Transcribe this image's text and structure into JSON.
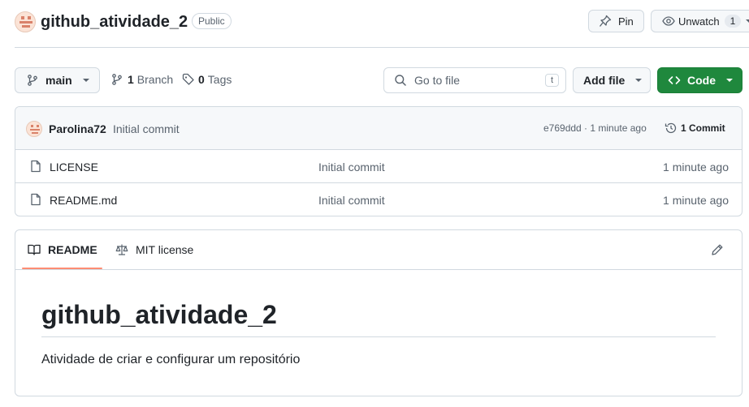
{
  "repo": {
    "name": "github_atividade_2",
    "visibility": "Public",
    "pin_label": "Pin",
    "unwatch_label": "Unwatch",
    "watch_count": "1"
  },
  "toolbar": {
    "branch": "main",
    "branches_count": "1",
    "branches_label": "Branch",
    "tags_count": "0",
    "tags_label": "Tags",
    "goto_placeholder": "Go to file",
    "goto_shortcut": "t",
    "add_file_label": "Add file",
    "code_label": "Code"
  },
  "commit": {
    "author": "Parolina72",
    "message": "Initial commit",
    "hash_time": "e769ddd · 1 minute ago",
    "count_label": "1 Commit"
  },
  "files": [
    {
      "name": "LICENSE",
      "message": "Initial commit",
      "time": "1 minute ago"
    },
    {
      "name": "README.md",
      "message": "Initial commit",
      "time": "1 minute ago"
    }
  ],
  "readme": {
    "tab_readme": "README",
    "tab_license": "MIT license",
    "heading": "github_atividade_2",
    "body": "Atividade de criar e configurar um repositório"
  },
  "colors": {
    "accent_green": "#1f883d",
    "underline_orange": "#fd8c73",
    "border": "#d1d9e0"
  }
}
